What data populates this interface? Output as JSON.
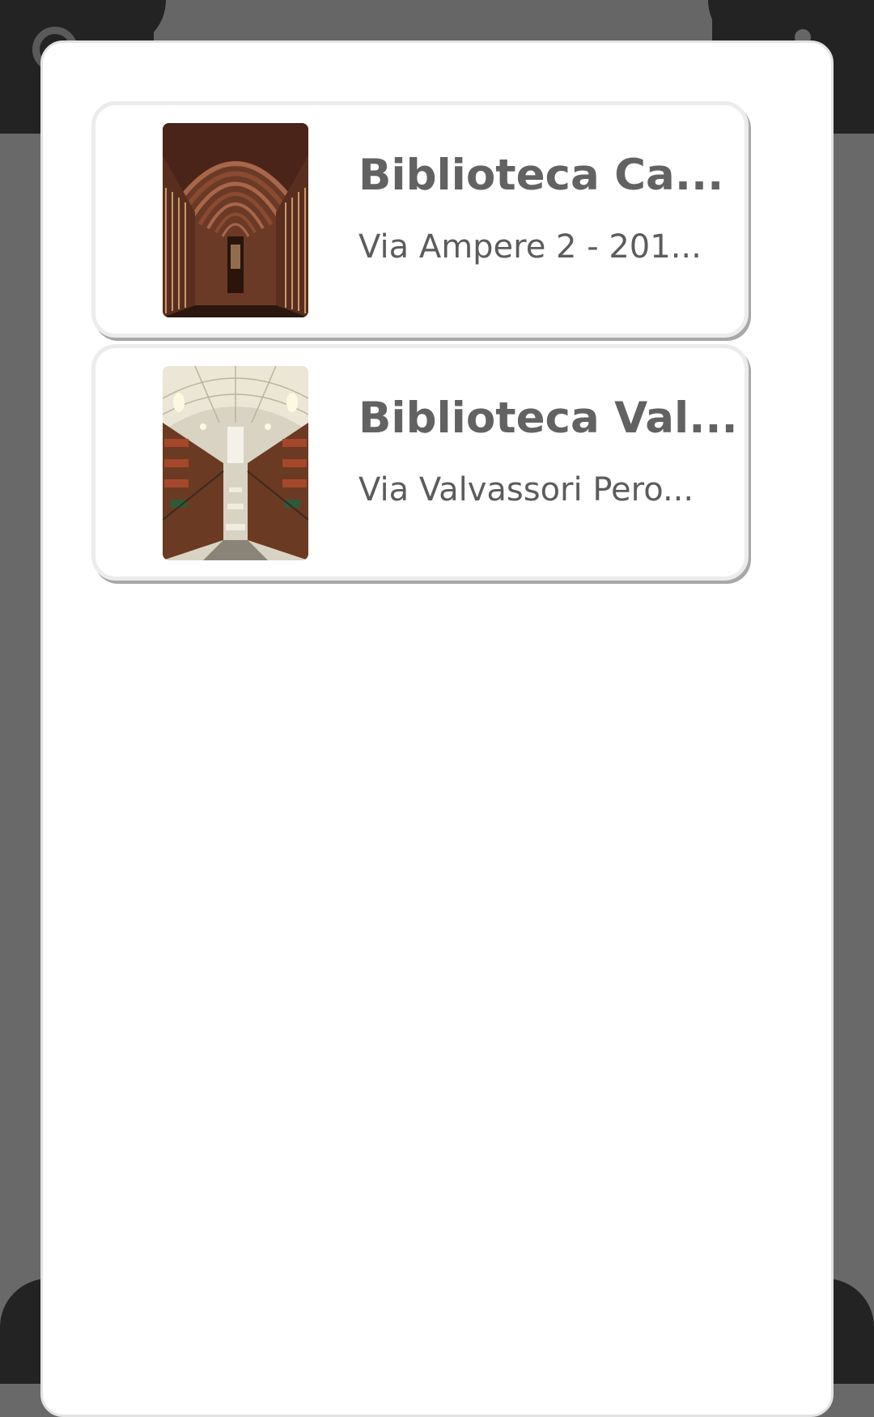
{
  "libraries": [
    {
      "name": "Biblioteca Ca...",
      "address": "Via Ampere 2 - 201...",
      "image": "library-vaulted-hall-photo"
    },
    {
      "name": "Biblioteca Val...",
      "address": "Via Valvassori Pero...",
      "image": "library-reading-room-photo"
    }
  ],
  "background": {
    "left_icon": "search-icon",
    "right_icon": "user-icon"
  },
  "colors": {
    "overlay": "#696969",
    "dark_bar": "#232323",
    "dialog": "#ffffff",
    "title_text": "#626262",
    "address_text": "#5c5c5c"
  }
}
